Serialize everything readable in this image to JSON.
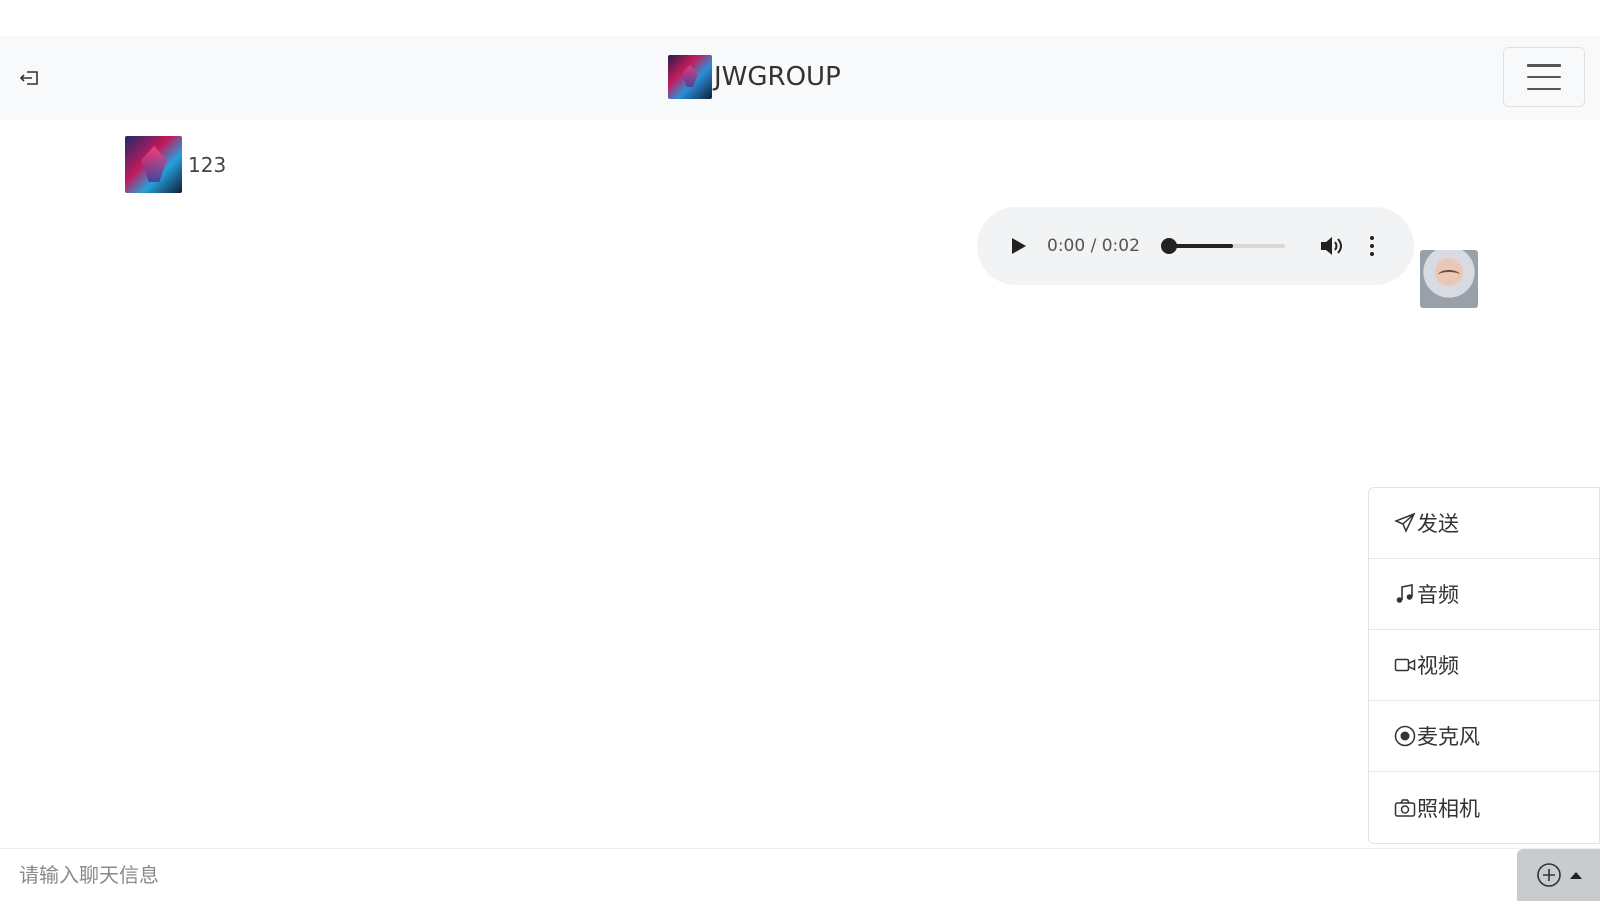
{
  "header": {
    "brand_name": "JWGROUP",
    "back_icon": "box-arrow-left-icon",
    "menu_icon": "hamburger-icon"
  },
  "messages": [
    {
      "side": "left",
      "text": "123",
      "avatar": "wolf-avatar"
    },
    {
      "side": "right",
      "type": "audio",
      "time": "0:00 / 0:02",
      "progress": 0.0,
      "volume": 0.55,
      "avatar": "girl-avatar"
    }
  ],
  "actions_menu": {
    "items": [
      {
        "icon": "send-icon",
        "label": "发送"
      },
      {
        "icon": "music-note-icon",
        "label": "音频"
      },
      {
        "icon": "video-icon",
        "label": "视频"
      },
      {
        "icon": "record-circle-icon",
        "label": "麦克风"
      },
      {
        "icon": "camera-icon",
        "label": "照相机"
      }
    ]
  },
  "input_bar": {
    "placeholder": "请输入聊天信息",
    "value": "",
    "plus_icon": "plus-circle-icon",
    "caret_icon": "caret-up-icon"
  }
}
